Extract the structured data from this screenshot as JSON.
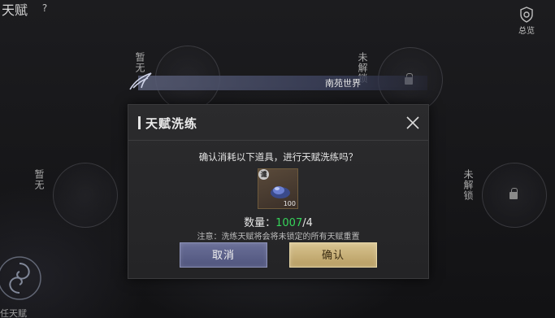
{
  "top_bar": {
    "title": "天赋",
    "help_glyph": "?",
    "preview_label": "总览",
    "preview_icon": "shield-gear-icon"
  },
  "background": {
    "banner_text": "南苑世界",
    "nodes": [
      {
        "label": "暂无",
        "locked": false
      },
      {
        "label": "未解锁",
        "locked": true
      },
      {
        "label": "暂无",
        "locked": false
      },
      {
        "label": "未解锁",
        "locked": true
      }
    ],
    "bottom_label": "任天赋"
  },
  "modal": {
    "title": "天赋洗练",
    "confirm_text": "确认消耗以下道具，进行天赋洗练吗？",
    "item": {
      "badge": "谶",
      "count_text": "100",
      "icon": "blue-gem-icon"
    },
    "qty_label": "数量：",
    "qty_have": "1007",
    "qty_need": "/4",
    "note": "注意：洗练天赋将会将未锁定的所有天赋重置",
    "cancel_label": "取消",
    "confirm_label": "确认"
  },
  "colors": {
    "accent_green": "#36d45a",
    "cancel_button": "#5d628a",
    "confirm_button": "#c9b27a"
  }
}
